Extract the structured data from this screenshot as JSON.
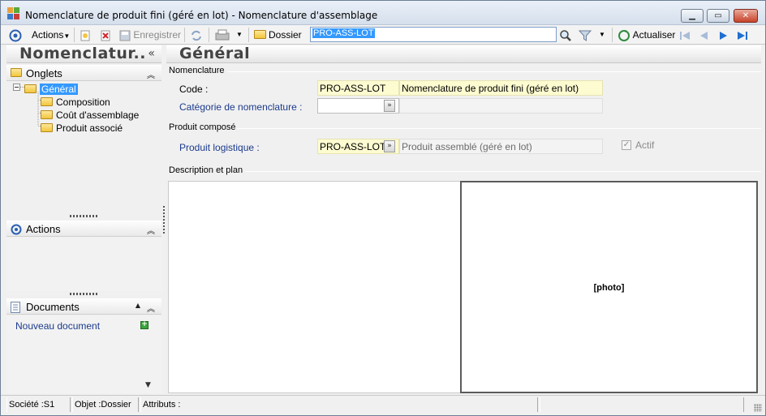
{
  "window": {
    "title": "Nomenclature de produit fini (géré en lot) -  Nomenclature d'assemblage",
    "minimize": "▁",
    "maximize": "▭",
    "close": "✕"
  },
  "toolbar": {
    "actions_label": "Actions",
    "save_label": "Enregistrer",
    "folder_label": "Dossier",
    "search_value": "PRO-ASS-LOT",
    "refresh_label": "Actualiser"
  },
  "left_panel": {
    "title": "Nomenclatur..",
    "collapse_glyph": "«",
    "tabs_section": "Onglets",
    "tree": [
      {
        "label": "Général",
        "selected": true
      },
      {
        "label": "Composition"
      },
      {
        "label": "Coût d'assemblage"
      },
      {
        "label": "Produit associé"
      }
    ],
    "actions_section": "Actions",
    "documents_section": "Documents",
    "new_document": "Nouveau document"
  },
  "main": {
    "title": "Général",
    "group_nomenclature": "Nomenclature",
    "code_label": "Code :",
    "code_value": "PRO-ASS-LOT",
    "code_desc": "Nomenclature de produit fini (géré en lot)",
    "category_label": "Catégorie de nomenclature :",
    "category_value": "",
    "category_desc": "",
    "group_product": "Produit composé",
    "logistic_label": "Produit logistique :",
    "logistic_value": "PRO-ASS-LOT",
    "logistic_desc": "Produit assemblé (géré en lot)",
    "active_label": "Actif",
    "active_checked": true,
    "group_description": "Description et plan",
    "photo_label": "[photo]"
  },
  "status": {
    "company": "Société :S1",
    "object": "Objet :Dossier",
    "attributes": "Attributs :"
  }
}
